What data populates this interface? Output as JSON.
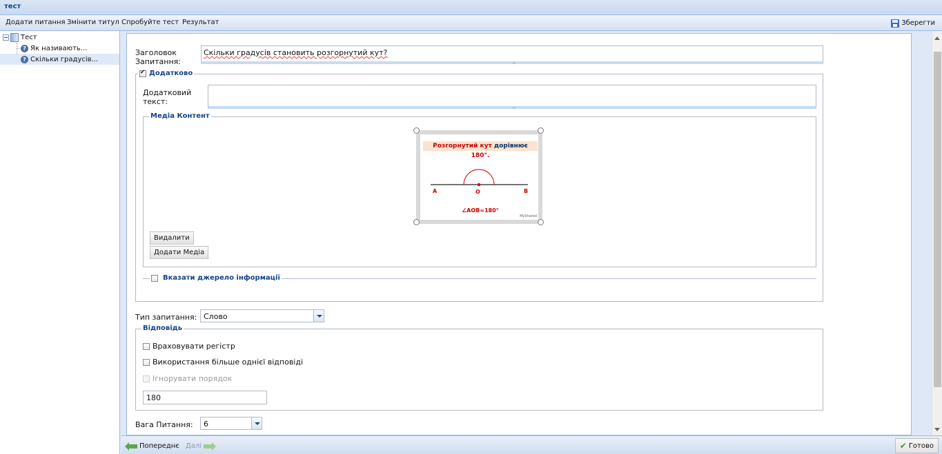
{
  "window": {
    "title": "тест"
  },
  "toolbar": {
    "add_question": "Додати питання",
    "change_title": "Змінити титул",
    "try_test": "Спробуйте тест",
    "result": "Результат",
    "save": "Зберегти"
  },
  "tree": {
    "root": "Тест",
    "items": [
      "Як називають...",
      "Скільки градусів..."
    ],
    "selected_index": 1
  },
  "question": {
    "title_label": "Заголовок Запитання:",
    "title_value": "Скільки градусів становить розгорнутий кут?",
    "extra_legend": "Додатково",
    "extra_checked": true,
    "extra_text_label": "Додатковий текст:",
    "extra_text_value": "",
    "media_legend": "Медіа Контент",
    "media_image": {
      "banner_red": "Розгорнутий кут",
      "banner_blue": "дорівнює",
      "banner_value": "180°.",
      "point_a": "A",
      "point_o": "O",
      "point_b": "B",
      "caption": "∠AOB=180°",
      "watermark": "MyShared"
    },
    "delete_button": "Видалити",
    "add_media_button": "Додати Медіа",
    "source_legend": "Вказати джерело інформації",
    "source_checked": false,
    "type_label": "Тип запитання:",
    "type_value": "Слово",
    "answer_legend": "Відповідь",
    "case_sensitive": "Враховувати регістр",
    "multiple_answers": "Використання більше однієї відповіді",
    "ignore_order": "Ігнорувати порядок",
    "answer_value": "180",
    "weight_label": "Вага Питання:",
    "weight_value": "6"
  },
  "footer": {
    "prev": "Попереднє",
    "next": "Далі",
    "done": "Готово"
  },
  "colors": {
    "accent": "#15428b",
    "border": "#99bbe8",
    "panel_bg": "#dfe8f6"
  }
}
